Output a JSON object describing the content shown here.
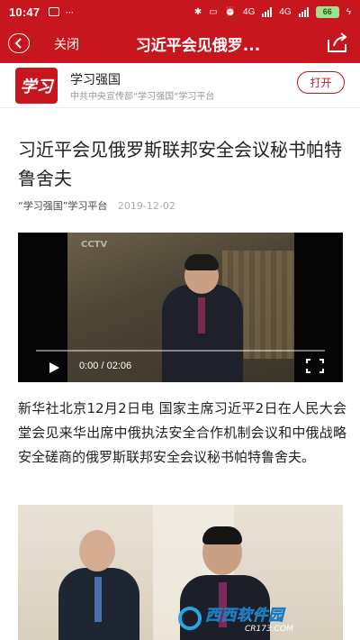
{
  "status_bar": {
    "time": "10:47",
    "battery": "66",
    "network_4g": "4G",
    "network_4g_2": "4G"
  },
  "nav": {
    "close_label": "关闭",
    "title": "习近平会见俄罗..."
  },
  "app_banner": {
    "logo_text": "学习",
    "name": "学习强国",
    "description": "中共中央宣传部“学习强国”学习平台",
    "open_label": "打开"
  },
  "article": {
    "title": "习近平会见俄罗斯联邦安全会议秘书帕特鲁舍夫",
    "source": "“学习强国”学习平台",
    "date": "2019-12-02",
    "paragraph": "新华社北京12月2日电 国家主席习近平2日在人民大会堂会见来华出席中俄执法安全合作机制会议和中俄战略安全磋商的俄罗斯联邦安全会议秘书帕特鲁舍夫。"
  },
  "video": {
    "time_display": "0:00 / 02:06",
    "progress": 0.0,
    "channel_logo": "CCTV"
  },
  "watermark": {
    "main": "西西软件园",
    "sub": "CR173.COM"
  },
  "colors": {
    "brand_red": "#c8161e",
    "watermark_blue": "#27a6e0"
  }
}
